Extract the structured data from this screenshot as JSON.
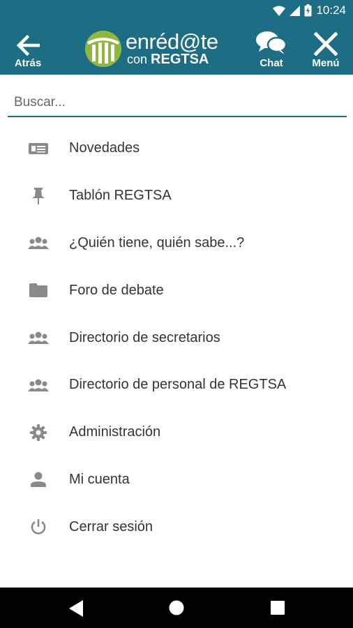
{
  "status": {
    "time": "10:24"
  },
  "appbar": {
    "back_label": "Atrás",
    "logo_line1": "enréd@te",
    "logo_line2_prefix": "con ",
    "logo_line2_brand": "REGTSA",
    "chat_label": "Chat",
    "menu_label": "Menú"
  },
  "search": {
    "placeholder": "Buscar..."
  },
  "menu": {
    "items": [
      {
        "label": "Novedades",
        "icon": "newspaper-icon"
      },
      {
        "label": "Tablón REGTSA",
        "icon": "pin-icon"
      },
      {
        "label": "¿Quién tiene, quién sabe...?",
        "icon": "group-icon"
      },
      {
        "label": "Foro de debate",
        "icon": "folder-icon"
      },
      {
        "label": "Directorio de secretarios",
        "icon": "group-icon"
      },
      {
        "label": "Directorio de personal de REGTSA",
        "icon": "group-icon"
      },
      {
        "label": "Administración",
        "icon": "gear-icon"
      },
      {
        "label": "Mi cuenta",
        "icon": "person-icon"
      },
      {
        "label": "Cerrar sesión",
        "icon": "power-icon"
      }
    ]
  },
  "colors": {
    "primary": "#1d6d84",
    "logo_green": "#8fb842",
    "icon_gray": "#8a8a8a",
    "text": "#333333"
  }
}
